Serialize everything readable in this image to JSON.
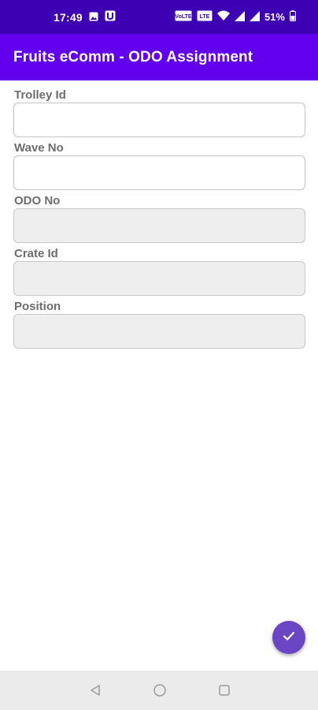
{
  "status_bar": {
    "time": "17:49",
    "battery": "51%",
    "icons": [
      "image-icon",
      "u-app-icon",
      "volte-icon",
      "volte-icon",
      "wifi-icon",
      "signal-icon",
      "signal-icon",
      "battery-icon"
    ],
    "lte1": "VoLTE",
    "lte2": "LTE"
  },
  "app_bar": {
    "title": "Fruits eComm - ODO Assignment"
  },
  "form": {
    "fields": [
      {
        "label": "Trolley Id",
        "value": "",
        "enabled": true
      },
      {
        "label": "Wave No",
        "value": "",
        "enabled": true
      },
      {
        "label": "ODO No",
        "value": "",
        "enabled": false
      },
      {
        "label": "Crate Id",
        "value": "",
        "enabled": false
      },
      {
        "label": "Position",
        "value": "",
        "enabled": false
      }
    ]
  },
  "fab": {
    "icon": "check-icon"
  },
  "nav_bar": {
    "buttons": [
      "back-icon",
      "home-icon",
      "recents-icon"
    ]
  },
  "colors": {
    "status_bar": "#3d00b3",
    "app_bar": "#6200ee",
    "fab": "#6a45c4",
    "label": "#6d6d6d",
    "disabled_field": "#eeeeee"
  }
}
